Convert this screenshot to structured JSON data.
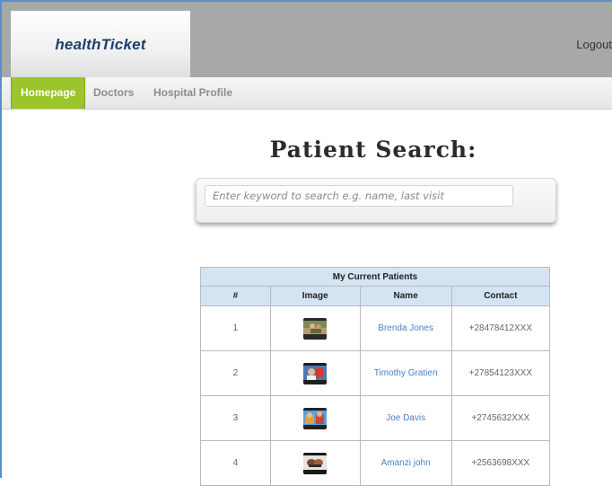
{
  "header": {
    "brand": "healthTicket",
    "logout_label": "Logout"
  },
  "nav": {
    "items": [
      {
        "label": "Homepage"
      },
      {
        "label": "Doctors"
      },
      {
        "label": "Hospital Profile"
      }
    ]
  },
  "page": {
    "title": "Patient Search:"
  },
  "search": {
    "placeholder": "Enter keyword to search e.g. name, last visit"
  },
  "table": {
    "caption": "My Current Patients",
    "columns": [
      "#",
      "Image",
      "Name",
      "Contact"
    ],
    "rows": [
      {
        "num": "1",
        "image_icon": "patient-photo-icon",
        "name": "Brenda Jones",
        "contact": "+28478412XXX"
      },
      {
        "num": "2",
        "image_icon": "patient-photo-icon",
        "name": "Timothy Gratien",
        "contact": "+27854123XXX"
      },
      {
        "num": "3",
        "image_icon": "patient-photo-icon",
        "name": "Joe Davis",
        "contact": "+2745632XXX"
      },
      {
        "num": "4",
        "image_icon": "patient-photo-icon",
        "name": "Amanzi john",
        "contact": "+2563698XXX"
      }
    ]
  },
  "colors": {
    "accent_green": "#9bc52a",
    "header_gray": "#a8a8a8",
    "table_header_blue": "#d4e4f3",
    "link_blue": "#4a82c4"
  }
}
